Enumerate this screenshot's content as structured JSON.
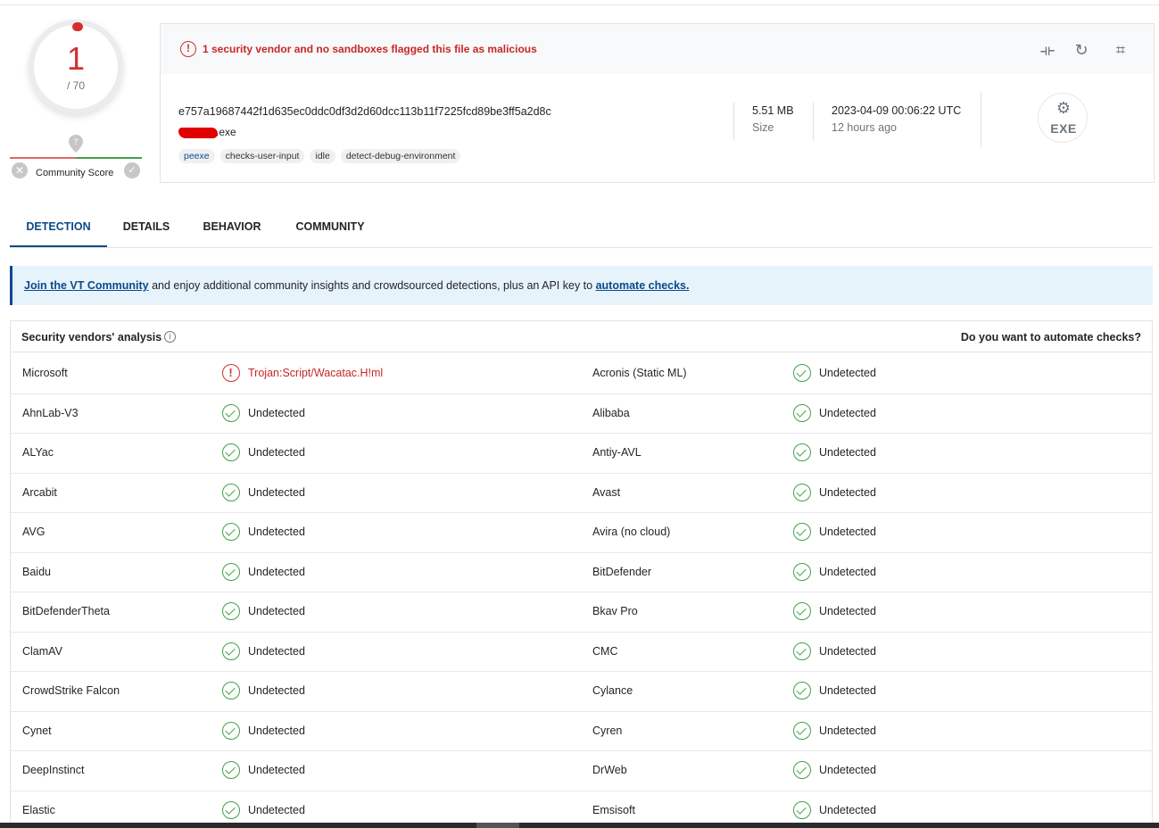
{
  "score": {
    "detections": "1",
    "total": "/ 70"
  },
  "community": {
    "label": "Community Score"
  },
  "alert": {
    "text": "1 security vendor and no sandboxes flagged this file as malicious"
  },
  "file": {
    "hash": "e757a19687442f1d635ec0ddc0df3d2d60dcc113b11f7225fcd89be3ff5a2d8c",
    "name_suffix": ".exe",
    "tags": [
      "peexe",
      "checks-user-input",
      "idle",
      "detect-debug-environment"
    ],
    "size_value": "5.51 MB",
    "size_label": "Size",
    "date_value": "2023-04-09 00:06:22 UTC",
    "date_label": "12 hours ago",
    "type_badge": "EXE"
  },
  "tabs": [
    "DETECTION",
    "DETAILS",
    "BEHAVIOR",
    "COMMUNITY"
  ],
  "banner": {
    "link1": "Join the VT Community",
    "middle": " and enjoy additional community insights and crowdsourced detections, plus an API key to ",
    "link2": "automate checks."
  },
  "section": {
    "title": "Security vendors' analysis",
    "right": "Do you want to automate checks?"
  },
  "colors": {
    "accent": "#0b4a8b",
    "malicious": "#d32f2f",
    "clean": "#43a047"
  },
  "vendors": [
    [
      {
        "name": "Microsoft",
        "result": "Trojan:Script/Wacatac.H!ml",
        "bad": true
      },
      {
        "name": "Acronis (Static ML)",
        "result": "Undetected"
      }
    ],
    [
      {
        "name": "AhnLab-V3",
        "result": "Undetected"
      },
      {
        "name": "Alibaba",
        "result": "Undetected"
      }
    ],
    [
      {
        "name": "ALYac",
        "result": "Undetected"
      },
      {
        "name": "Antiy-AVL",
        "result": "Undetected"
      }
    ],
    [
      {
        "name": "Arcabit",
        "result": "Undetected"
      },
      {
        "name": "Avast",
        "result": "Undetected"
      }
    ],
    [
      {
        "name": "AVG",
        "result": "Undetected"
      },
      {
        "name": "Avira (no cloud)",
        "result": "Undetected"
      }
    ],
    [
      {
        "name": "Baidu",
        "result": "Undetected"
      },
      {
        "name": "BitDefender",
        "result": "Undetected"
      }
    ],
    [
      {
        "name": "BitDefenderTheta",
        "result": "Undetected"
      },
      {
        "name": "Bkav Pro",
        "result": "Undetected"
      }
    ],
    [
      {
        "name": "ClamAV",
        "result": "Undetected"
      },
      {
        "name": "CMC",
        "result": "Undetected"
      }
    ],
    [
      {
        "name": "CrowdStrike Falcon",
        "result": "Undetected"
      },
      {
        "name": "Cylance",
        "result": "Undetected"
      }
    ],
    [
      {
        "name": "Cynet",
        "result": "Undetected"
      },
      {
        "name": "Cyren",
        "result": "Undetected"
      }
    ],
    [
      {
        "name": "DeepInstinct",
        "result": "Undetected"
      },
      {
        "name": "DrWeb",
        "result": "Undetected"
      }
    ],
    [
      {
        "name": "Elastic",
        "result": "Undetected"
      },
      {
        "name": "Emsisoft",
        "result": "Undetected"
      }
    ]
  ]
}
